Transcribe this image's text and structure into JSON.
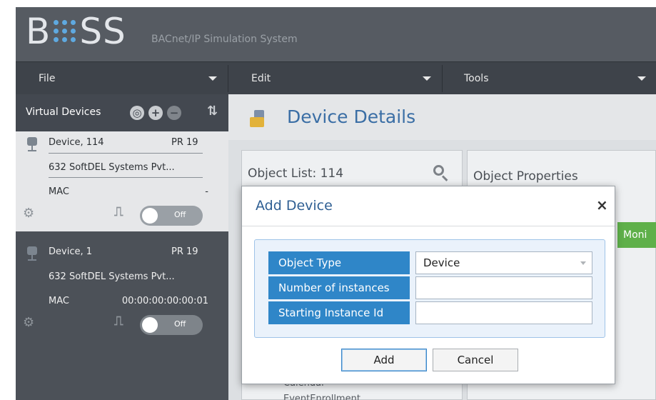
{
  "app": {
    "logo_left": "B",
    "logo_right": "SS",
    "subtitle": "BACnet/IP Simulation System"
  },
  "menu": [
    {
      "label": "File"
    },
    {
      "label": "Edit"
    },
    {
      "label": "Tools"
    }
  ],
  "sidebar": {
    "title": "Virtual Devices",
    "devices": [
      {
        "name": "Device, 114",
        "pr": "PR 19",
        "vendor": "632  SoftDEL Systems Pvt...",
        "mac_label": "MAC",
        "mac": "-",
        "toggle": "Off",
        "selected": true
      },
      {
        "name": "Device, 1",
        "pr": "PR 19",
        "vendor": "632  SoftDEL Systems Pvt...",
        "mac_label": "MAC",
        "mac": "00:00:00:00:00:01",
        "toggle": "Off",
        "selected": false
      }
    ]
  },
  "main": {
    "title": "Device Details",
    "object_list": {
      "title": "Object List: 114",
      "items": [
        "Calendar",
        "EventEnrollment"
      ]
    },
    "object_properties": {
      "title": "Object Properties",
      "monitor_label": "Moni"
    }
  },
  "modal": {
    "title": "Add Device",
    "close": "×",
    "fields": [
      {
        "label": "Object Type",
        "value": "Device",
        "type": "select"
      },
      {
        "label": "Number of instances",
        "value": "",
        "type": "input"
      },
      {
        "label": "Starting Instance Id",
        "value": "",
        "type": "input"
      }
    ],
    "add_label": "Add",
    "cancel_label": "Cancel"
  },
  "colors": {
    "accent": "#2f86c8",
    "title_blue": "#3a6ea5",
    "monitor_green": "#5fb04a"
  }
}
